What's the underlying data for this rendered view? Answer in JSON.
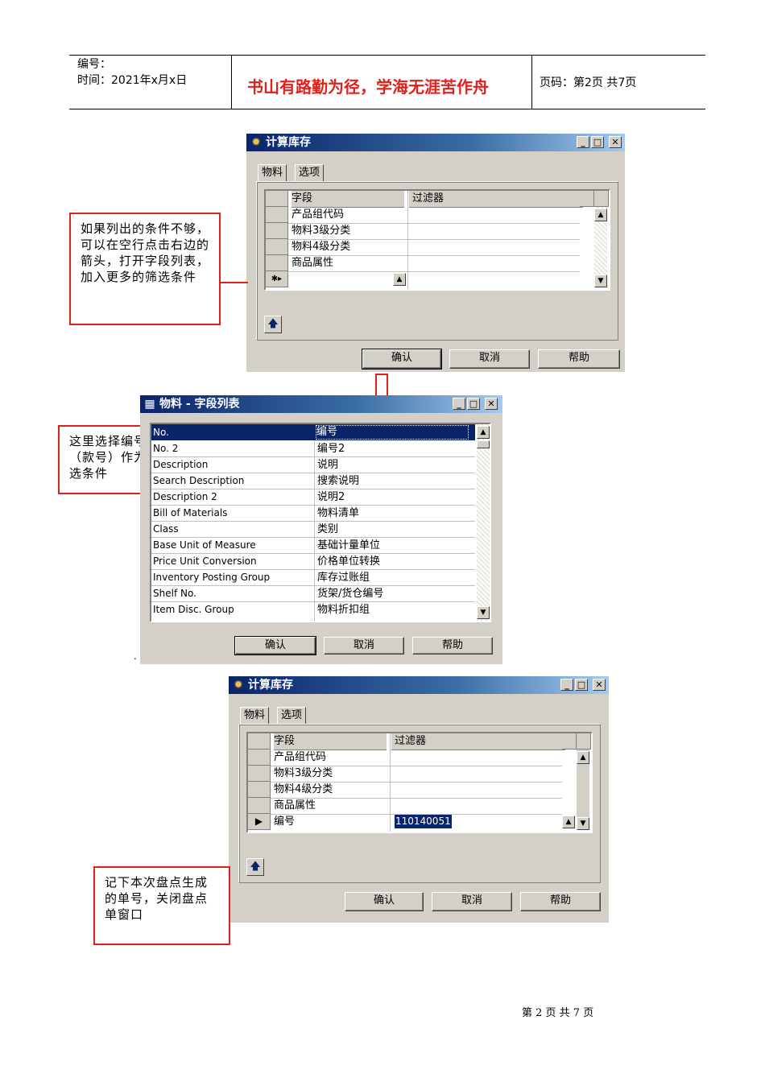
{
  "header": {
    "number_label": "编号：",
    "time_label": "时间：2021年x月x日",
    "motto": "书山有路勤为径，学海无涯苦作舟",
    "page_label": "页码：第2页 共7页"
  },
  "dialog1": {
    "title": "计算库存",
    "tabs": [
      "物料",
      "选项"
    ],
    "columns": [
      "字段",
      "过滤器"
    ],
    "rows": [
      {
        "field": "产品组代码",
        "filter": ""
      },
      {
        "field": "物料3级分类",
        "filter": ""
      },
      {
        "field": "物料4级分类",
        "filter": ""
      },
      {
        "field": "商品属性",
        "filter": ""
      },
      {
        "field": "",
        "filter": ""
      }
    ],
    "new_row_marker": "✱▸",
    "buttons": {
      "ok": "确认",
      "cancel": "取消",
      "help": "帮助"
    }
  },
  "dialog2": {
    "title": "物料 - 字段列表",
    "rows": [
      {
        "name": "No.",
        "caption": "编号"
      },
      {
        "name": "No. 2",
        "caption": "编号2"
      },
      {
        "name": "Description",
        "caption": "说明"
      },
      {
        "name": "Search Description",
        "caption": "搜索说明"
      },
      {
        "name": "Description 2",
        "caption": "说明2"
      },
      {
        "name": "Bill of Materials",
        "caption": "物料清单"
      },
      {
        "name": "Class",
        "caption": "类别"
      },
      {
        "name": "Base Unit of Measure",
        "caption": "基础计量单位"
      },
      {
        "name": "Price Unit Conversion",
        "caption": "价格单位转换"
      },
      {
        "name": "Inventory Posting Group",
        "caption": "库存过账组"
      },
      {
        "name": "Shelf No.",
        "caption": "货架/货仓编号"
      },
      {
        "name": "Item Disc. Group",
        "caption": "物料折扣组"
      }
    ],
    "buttons": {
      "ok": "确认",
      "cancel": "取消",
      "help": "帮助"
    }
  },
  "dialog3": {
    "title": "计算库存",
    "tabs": [
      "物料",
      "选项"
    ],
    "columns": [
      "字段",
      "过滤器"
    ],
    "rows": [
      {
        "field": "产品组代码",
        "filter": ""
      },
      {
        "field": "物料3级分类",
        "filter": ""
      },
      {
        "field": "物料4级分类",
        "filter": ""
      },
      {
        "field": "商品属性",
        "filter": ""
      },
      {
        "field": "编号",
        "filter": "110140051"
      }
    ],
    "buttons": {
      "ok": "确认",
      "cancel": "取消",
      "help": "帮助"
    }
  },
  "callouts": {
    "c1": "如果列出的条件不够，可以在空行点击右边的箭头，打开字段列表，加入更多的筛选条件",
    "c2": "这里选择编号（款号）作为筛选条件",
    "c3": "记下本次盘点生成的单号，关闭盘点单窗口"
  },
  "stray_dot": ".",
  "footer": "第 2 页 共 7 页"
}
